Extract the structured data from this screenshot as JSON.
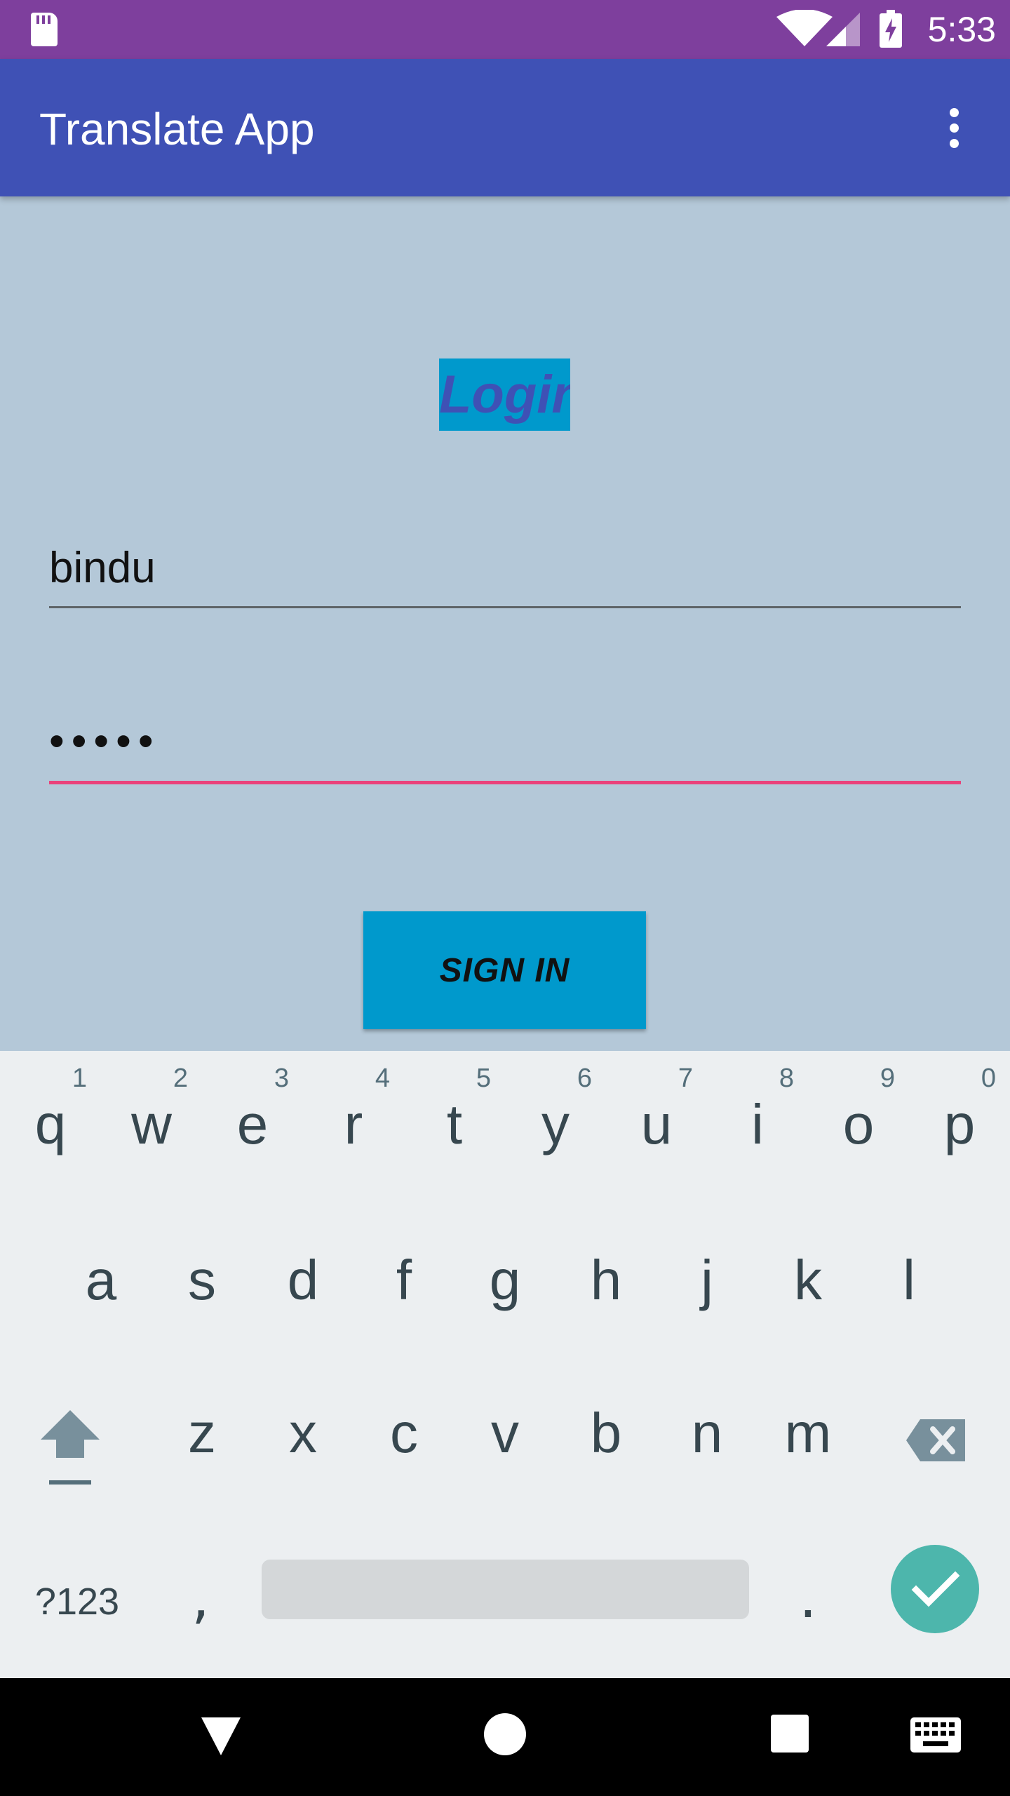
{
  "status_bar": {
    "time": "5:33",
    "icons": [
      "sd-card-icon",
      "wifi-icon",
      "signal-icon",
      "battery-charging-icon"
    ],
    "background": "#7E3F9D"
  },
  "app_bar": {
    "title": "Translate App",
    "menu_icon": "more-vert-icon",
    "background": "#3F51B5"
  },
  "login": {
    "heading": "Login",
    "username_value": "bindu",
    "password_value": "•••••",
    "sign_in_label": "SIGN IN",
    "accent_color": "#0099CC",
    "focus_underline_color": "#E9427B"
  },
  "keyboard": {
    "row1": [
      {
        "letter": "q",
        "hint": "1"
      },
      {
        "letter": "w",
        "hint": "2"
      },
      {
        "letter": "e",
        "hint": "3"
      },
      {
        "letter": "r",
        "hint": "4"
      },
      {
        "letter": "t",
        "hint": "5"
      },
      {
        "letter": "y",
        "hint": "6"
      },
      {
        "letter": "u",
        "hint": "7"
      },
      {
        "letter": "i",
        "hint": "8"
      },
      {
        "letter": "o",
        "hint": "9"
      },
      {
        "letter": "p",
        "hint": "0"
      }
    ],
    "row2": [
      "a",
      "s",
      "d",
      "f",
      "g",
      "h",
      "j",
      "k",
      "l"
    ],
    "row3": [
      "z",
      "x",
      "c",
      "v",
      "b",
      "n",
      "m"
    ],
    "symbols_label": "?123",
    "comma_label": ",",
    "period_label": ".",
    "enter_color": "#4DB6AC"
  },
  "nav_bar": {
    "icons": [
      "back-icon",
      "home-icon",
      "recents-icon",
      "keyboard-switch-icon"
    ]
  }
}
